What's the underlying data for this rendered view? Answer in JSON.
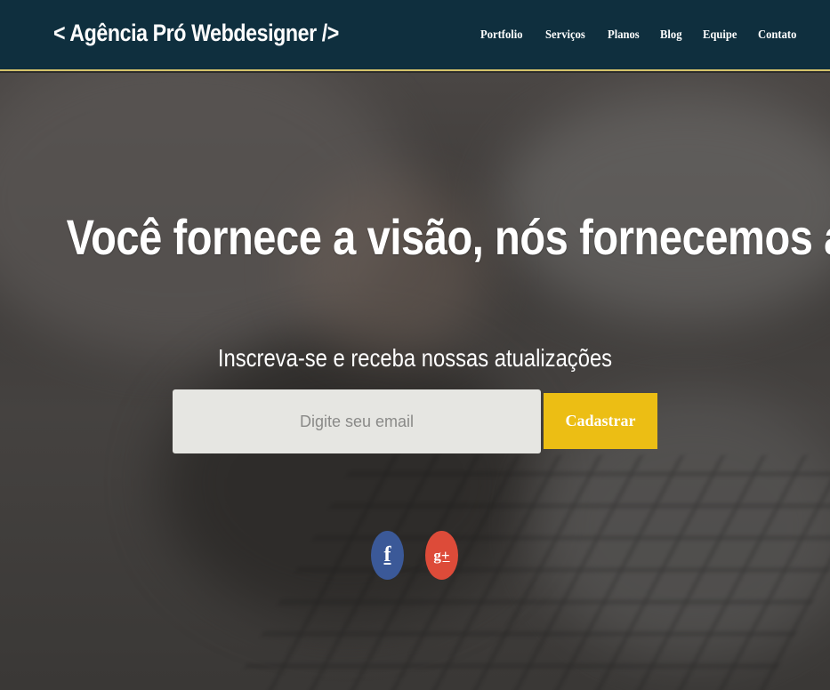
{
  "header": {
    "logo": "< Agência Pró Webdesigner />",
    "nav": [
      {
        "label": "Portfolio"
      },
      {
        "label": "Serviços"
      },
      {
        "label": "Planos"
      },
      {
        "label": "Blog"
      },
      {
        "label": "Equipe"
      },
      {
        "label": "Contato"
      }
    ]
  },
  "hero": {
    "headline": "Você fornece a visão, nós fornecemos a solução.",
    "subtitle": "Inscreva-se e receba nossas atualizações",
    "email_placeholder": "Digite seu email",
    "submit_label": "Cadastrar"
  },
  "social": {
    "facebook_glyph": "f",
    "googleplus_glyph": "g+"
  },
  "colors": {
    "header_bg": "#0f2f3e",
    "accent": "#ecbe14",
    "facebook": "#3b5998",
    "googleplus": "#dd4b39"
  }
}
